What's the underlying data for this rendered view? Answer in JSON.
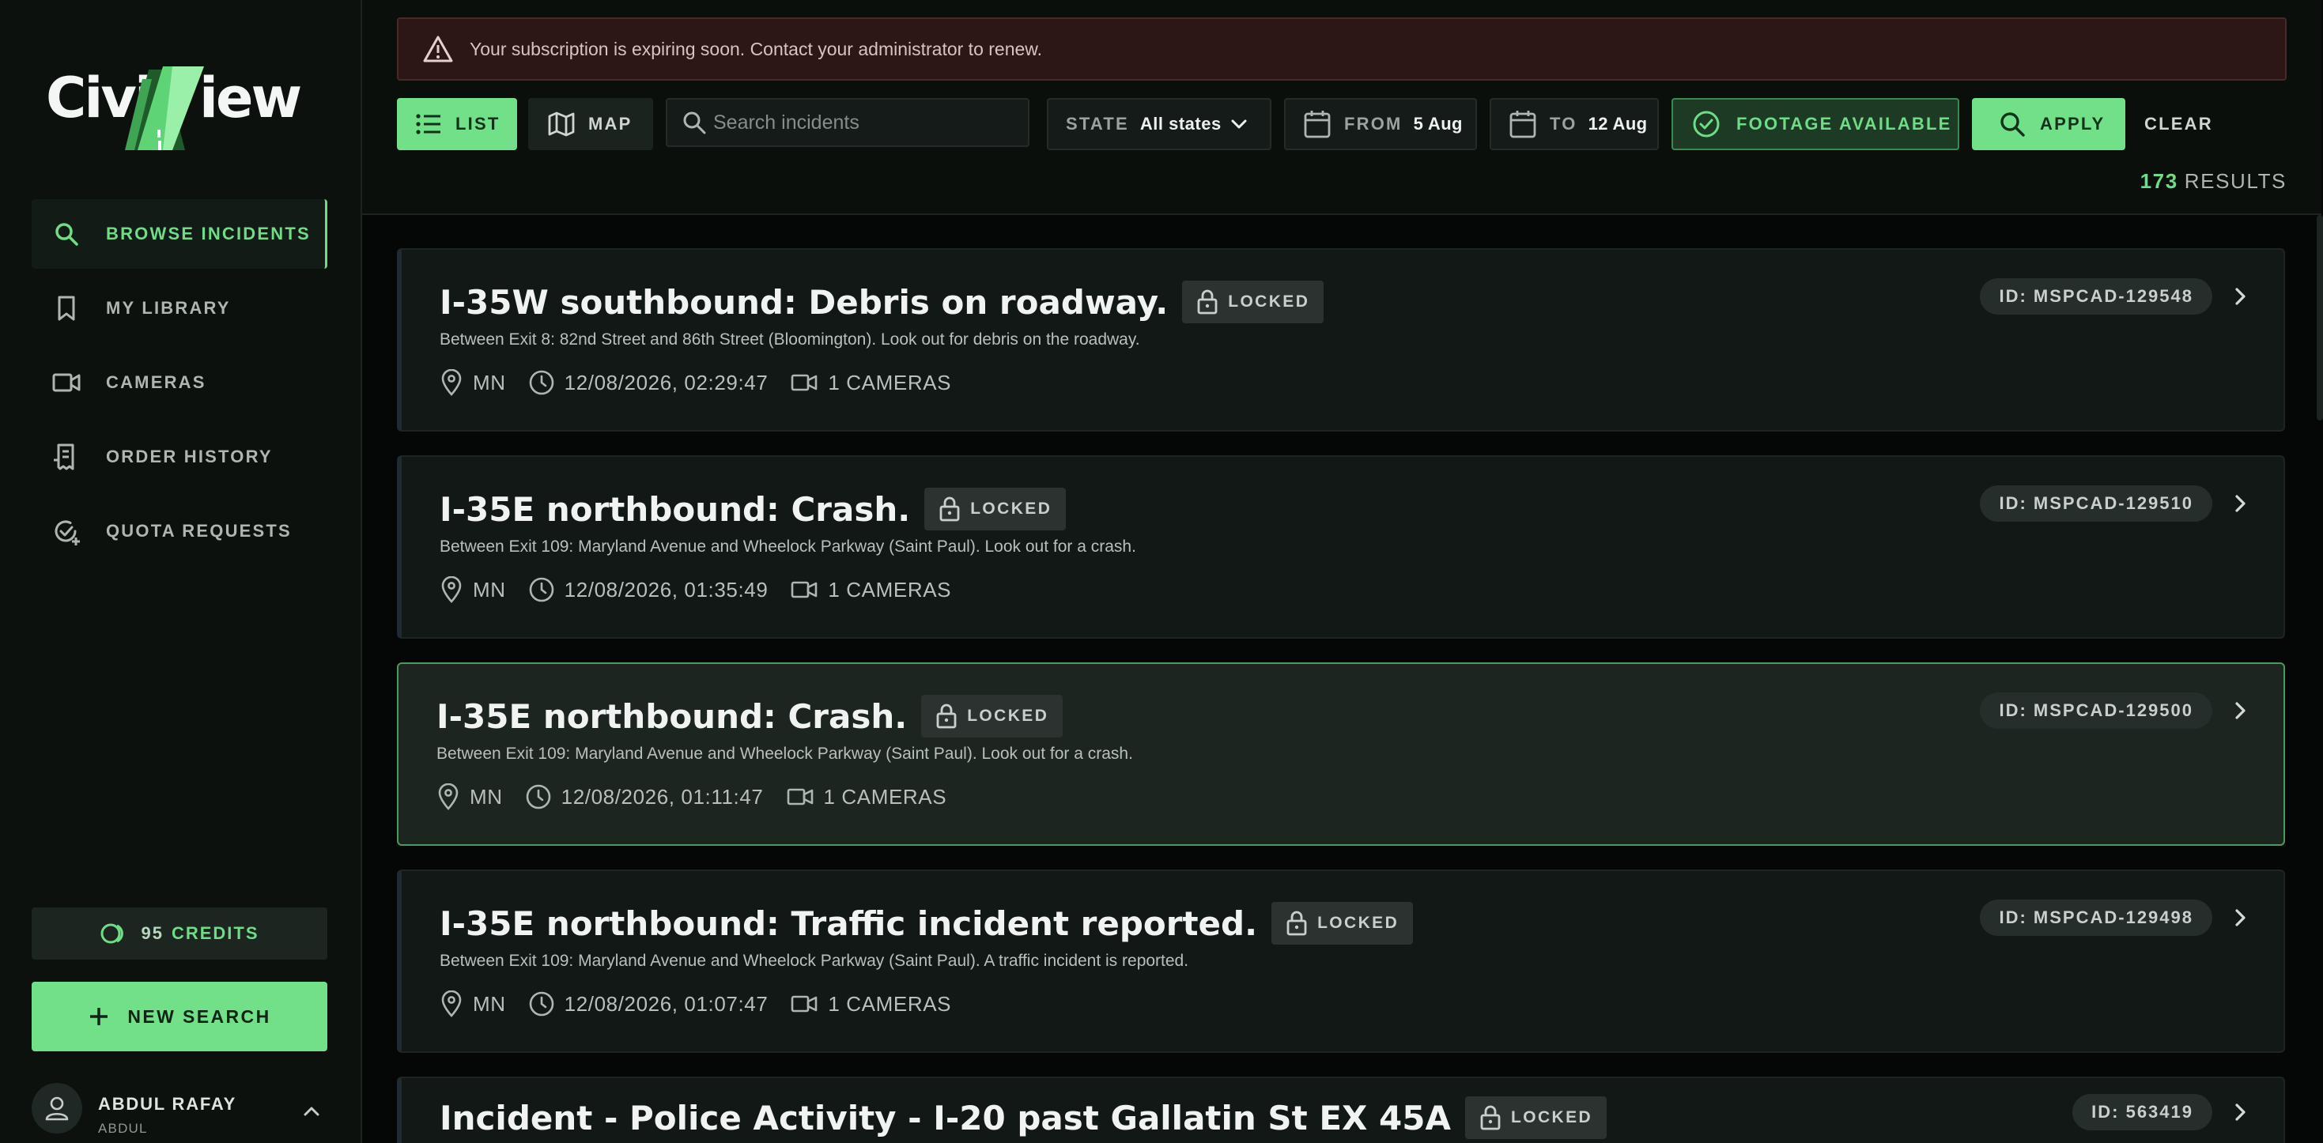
{
  "brand": {
    "name": "CivicView",
    "accent": "#72e088"
  },
  "sidebar": {
    "items": [
      {
        "label": "BROWSE INCIDENTS",
        "icon": "search-icon",
        "active": true
      },
      {
        "label": "MY LIBRARY",
        "icon": "bookmark-icon",
        "active": false
      },
      {
        "label": "CAMERAS",
        "icon": "video-camera-icon",
        "active": false
      },
      {
        "label": "ORDER HISTORY",
        "icon": "receipt-icon",
        "active": false
      },
      {
        "label": "QUOTA REQUESTS",
        "icon": "check-badge-icon",
        "active": false
      }
    ],
    "credits": {
      "count": "95",
      "label": "CREDITS"
    },
    "new_search_label": "NEW SEARCH",
    "user": {
      "name": "ABDUL RAFAY",
      "sub": "ABDUL"
    }
  },
  "alert": {
    "text": "Your subscription is expiring soon. Contact your administrator to renew.",
    "color": "#2c1616"
  },
  "toolbar": {
    "list_label": "LIST",
    "map_label": "MAP",
    "search_placeholder": "Search incidents",
    "state_key": "STATE",
    "state_value": "All states",
    "from_key": "FROM",
    "from_value": "5 Aug",
    "to_key": "TO",
    "to_value": "12 Aug",
    "footage_label": "FOOTAGE AVAILABLE",
    "apply_label": "APPLY",
    "clear_label": "CLEAR"
  },
  "results": {
    "count": "173",
    "label": "RESULTS"
  },
  "incidents": [
    {
      "title": "I-35W southbound: Debris on roadway.",
      "locked_label": "LOCKED",
      "description": "Between Exit 8: 82nd Street and 86th Street (Bloomington). Look out for debris on the roadway.",
      "state": "MN",
      "datetime": "12/08/2026, 02:29:47",
      "cameras": "1 CAMERAS",
      "id": "ID: MSPCAD-129548"
    },
    {
      "title": "I-35E northbound: Crash.",
      "locked_label": "LOCKED",
      "description": "Between Exit 109: Maryland Avenue and Wheelock Parkway (Saint Paul). Look out for a crash.",
      "state": "MN",
      "datetime": "12/08/2026, 01:35:49",
      "cameras": "1 CAMERAS",
      "id": "ID: MSPCAD-129510"
    },
    {
      "title": "I-35E northbound: Crash.",
      "locked_label": "LOCKED",
      "description": "Between Exit 109: Maryland Avenue and Wheelock Parkway (Saint Paul). Look out for a crash.",
      "state": "MN",
      "datetime": "12/08/2026, 01:11:47",
      "cameras": "1 CAMERAS",
      "id": "ID: MSPCAD-129500"
    },
    {
      "title": "I-35E northbound: Traffic incident reported.",
      "locked_label": "LOCKED",
      "description": "Between Exit 109: Maryland Avenue and Wheelock Parkway (Saint Paul). A traffic incident is reported.",
      "state": "MN",
      "datetime": "12/08/2026, 01:07:47",
      "cameras": "1 CAMERAS",
      "id": "ID: MSPCAD-129498"
    },
    {
      "title": "Incident - Police Activity - I-20 past Gallatin St EX 45A",
      "locked_label": "LOCKED",
      "description": "",
      "state": "",
      "datetime": "",
      "cameras": "",
      "id": "ID: 563419"
    }
  ]
}
